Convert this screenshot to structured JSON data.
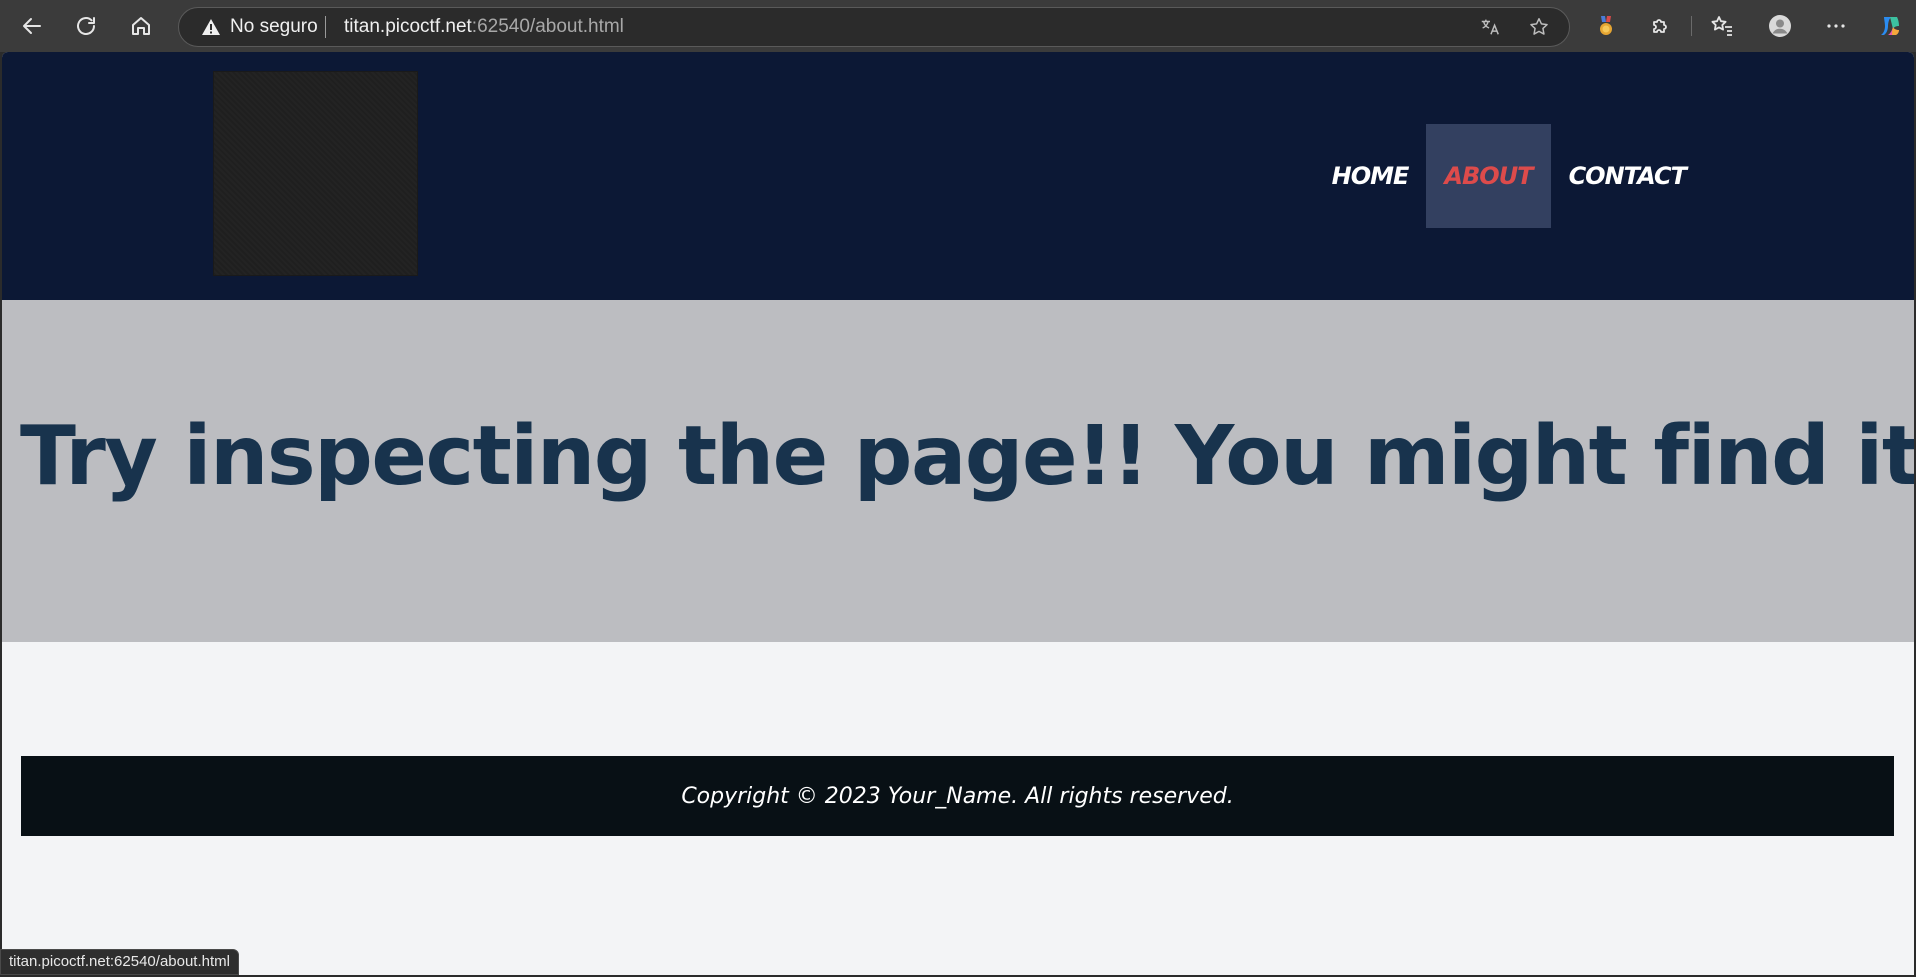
{
  "browser": {
    "security_label": "No seguro",
    "url_host": "titan.picoctf.net",
    "url_path": ":62540/about.html",
    "status_url": "titan.picoctf.net:62540/about.html",
    "icons": {
      "back": "back-arrow-icon",
      "reload": "reload-icon",
      "home": "home-icon",
      "warning": "warning-icon",
      "translate": "translate-icon",
      "favorite": "star-icon",
      "rewards": "medal-icon",
      "extensions": "puzzle-icon",
      "favorites": "favorites-list-icon",
      "profile": "avatar-icon",
      "menu": "more-icon",
      "copilot": "copilot-icon"
    }
  },
  "site": {
    "nav": [
      {
        "label": "HOME",
        "active": false
      },
      {
        "label": "ABOUT",
        "active": true
      },
      {
        "label": "CONTACT",
        "active": false
      }
    ],
    "hero_title": "Try inspecting the page!! You might find it there",
    "footer_text": "Copyright © 2023 Your_Name. All rights reserved.",
    "colors": {
      "header_bg": "#0c1835",
      "nav_active_bg": "#334060",
      "nav_active_text": "#dd4b4b",
      "hero_bg": "#bcbdc1",
      "hero_text": "#18334d",
      "footer_bg": "#081015"
    }
  }
}
